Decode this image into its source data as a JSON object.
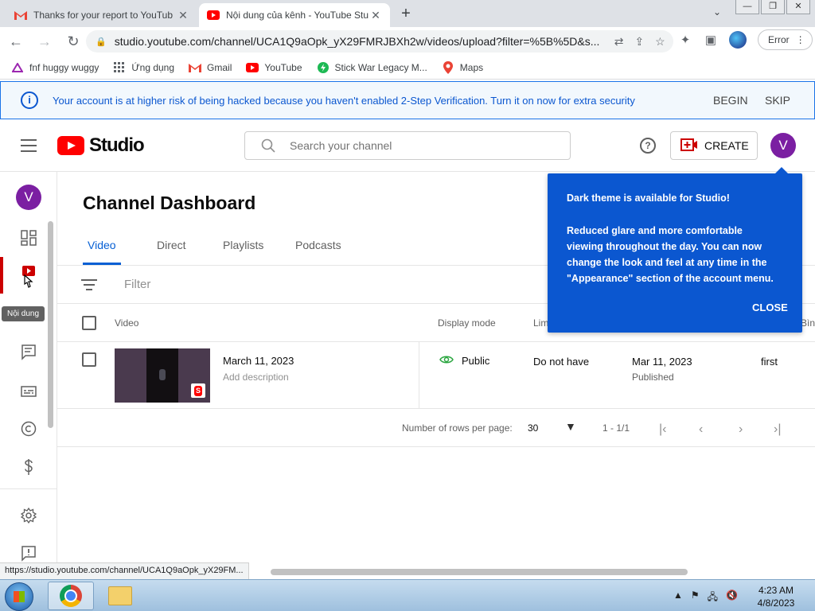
{
  "browser": {
    "tabs": [
      {
        "title": "Thanks for your report to YouTub",
        "icon": "gmail-icon"
      },
      {
        "title": "Nội dung của kênh - YouTube Stu",
        "icon": "youtube-icon"
      }
    ],
    "url": "studio.youtube.com/channel/UCA1Q9aOpk_yX29FMRJBXh2w/videos/upload?filter=%5B%5D&s...",
    "profile_button": "Error",
    "bookmarks": [
      {
        "label": "fnf huggy wuggy"
      },
      {
        "label": "Ứng dụng"
      },
      {
        "label": "Gmail"
      },
      {
        "label": "YouTube"
      },
      {
        "label": "Stick War Legacy M..."
      },
      {
        "label": "Maps"
      }
    ]
  },
  "banner": {
    "message": "Your account is at higher risk of being hacked because you haven't enabled 2-Step Verification. Turn it on now for extra security",
    "begin": "BEGIN",
    "skip": "SKIP"
  },
  "header": {
    "logo_text": "Studio",
    "search_placeholder": "Search your channel",
    "help": "?",
    "create": "CREATE",
    "avatar_letter": "V"
  },
  "nav": {
    "avatar_letter": "V",
    "tooltip": "Nội dung"
  },
  "main": {
    "title": "Channel Dashboard",
    "tabs": [
      "Video",
      "Direct",
      "Playlists",
      "Podcasts"
    ],
    "filter_placeholder": "Filter",
    "columns": {
      "video": "Video",
      "display_mode": "Display mode",
      "restrictions": "Lim",
      "comments": "Bìn"
    },
    "rows": [
      {
        "title": "March 11, 2023",
        "description": "Add description",
        "visibility": "Public",
        "restrictions": "Do not have",
        "date": "Mar 11, 2023",
        "status": "Published",
        "views": "first"
      }
    ],
    "pagination": {
      "rows_per_page_label": "Number of rows per page:",
      "rows_per_page": "30",
      "range": "1 - 1/1"
    }
  },
  "popup": {
    "title": "Dark theme is available for Studio!",
    "body": "Reduced glare and more comfortable viewing throughout the day. You can now change the look and feel at any time in the \"Appearance\" section of the account menu.",
    "close": "CLOSE"
  },
  "status_url": "https://studio.youtube.com/channel/UCA1Q9aOpk_yX29FM...",
  "taskbar": {
    "time": "4:23 AM",
    "date": "4/8/2023"
  },
  "colors": {
    "accent_blue": "#065fd4",
    "popup_blue": "#0b57d0",
    "youtube_red": "#ff0000",
    "avatar_purple": "#7b1fa2"
  }
}
